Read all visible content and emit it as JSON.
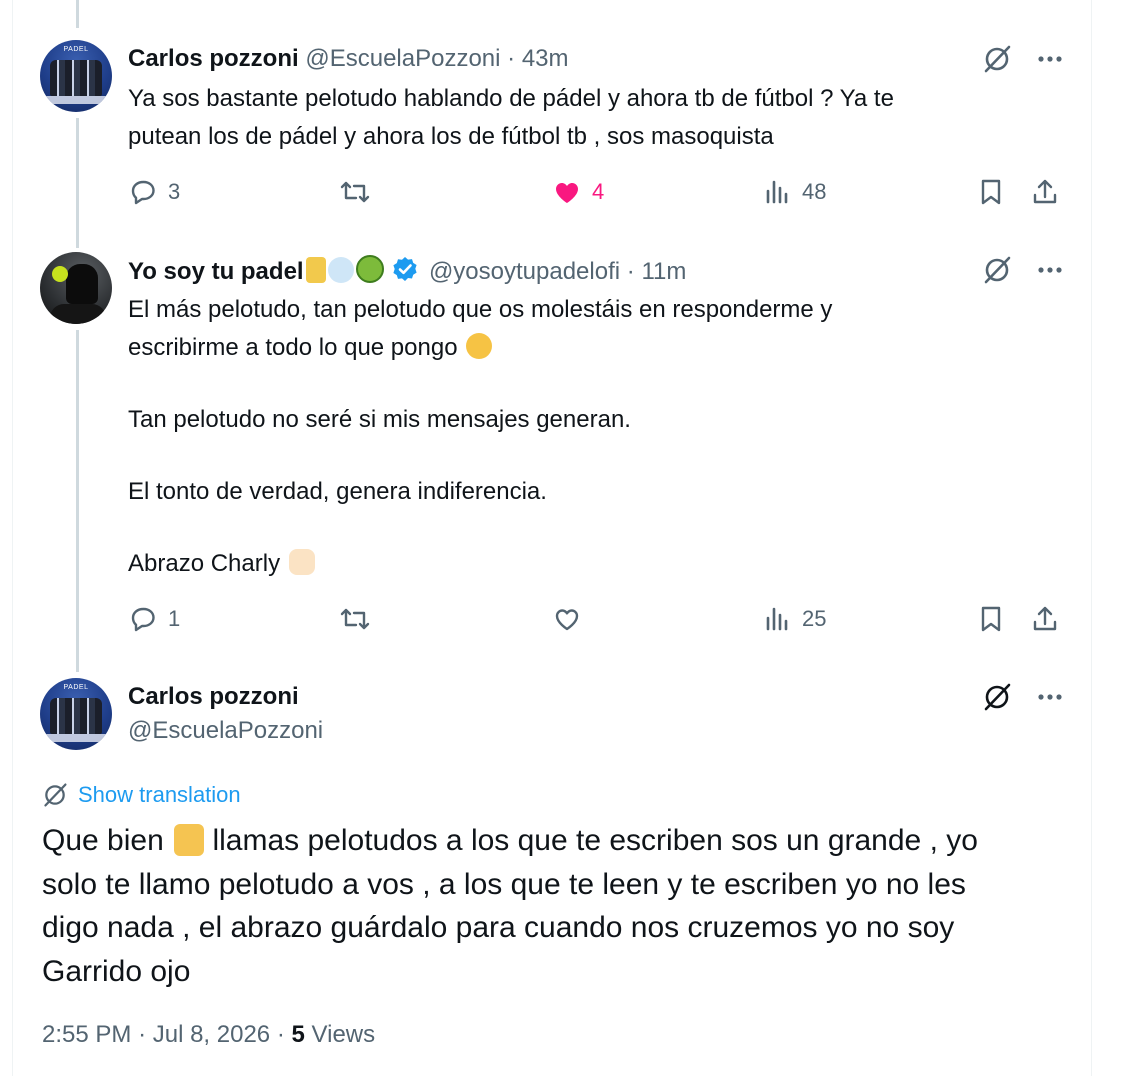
{
  "tweets": [
    {
      "name": "Carlos pozzoni",
      "handle": "@EscuelaPozzoni",
      "time": "43m",
      "text_lines": [
        "Ya sos bastante pelotudo hablando de pádel y ahora tb de fútbol ? Ya te",
        "putean los de pádel y ahora los de fútbol tb , sos masoquista"
      ],
      "replies": "3",
      "reposts": "",
      "likes": "4",
      "liked": true,
      "views": "48"
    },
    {
      "name": "Yo soy tu padel",
      "name_emojis": [
        "arm-emoji",
        "dash-emoji",
        "tennis-ball-emoji"
      ],
      "handle": "@yosoytupadelofi",
      "time": "11m",
      "verified": true,
      "paragraphs": [
        [
          "El más pelotudo, tan pelotudo que os molestáis en responderme y",
          "escribirme a todo lo que pongo"
        ],
        [
          "Tan pelotudo no seré si mis mensajes generan."
        ],
        [
          "El tonto de verdad, genera indiferencia."
        ],
        [
          "Abrazo Charly"
        ]
      ],
      "replies": "1",
      "reposts": "",
      "likes": "",
      "views": "25"
    }
  ],
  "main_tweet": {
    "name": "Carlos pozzoni",
    "handle": "@EscuelaPozzoni",
    "show_translation": "Show translation",
    "text_lines": [
      [
        "Que bien",
        "llamas pelotudos a los que te escriben sos un grande , yo"
      ],
      "solo te llamo pelotudo a vos , a los que te leen y te escriben yo no les",
      "digo nada , el abrazo guárdalo para cuando nos cruzemos yo no soy",
      "Garrido ojo"
    ],
    "time": "2:55 PM",
    "date": "Jul 8, 2026",
    "views_count": "5",
    "views_label": "Views"
  },
  "colors": {
    "text": "#0f1419",
    "secondary": "#536471",
    "link": "#1d9bf0",
    "like": "#f91880",
    "thread_line": "#cfd9de"
  }
}
